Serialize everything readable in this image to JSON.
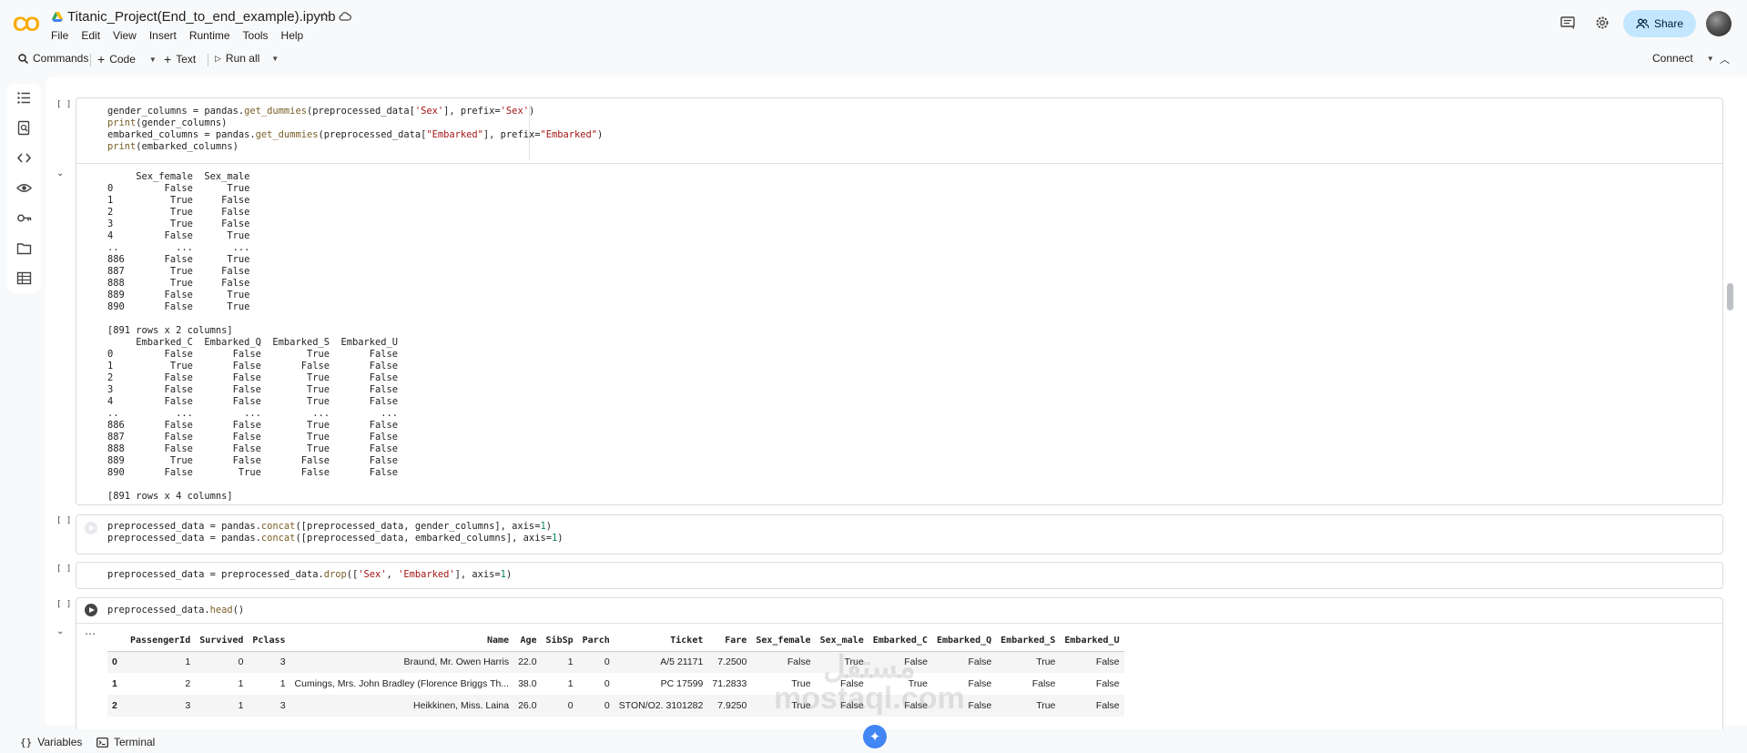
{
  "app": {
    "logo_text": "CO",
    "notebook_title": "Titanic_Project(End_to_end_example).ipynb",
    "menu": [
      "File",
      "Edit",
      "View",
      "Insert",
      "Runtime",
      "Tools",
      "Help"
    ],
    "share_label": "Share"
  },
  "toolbar": {
    "commands": "Commands",
    "code": "Code",
    "text": "Text",
    "run_all": "Run all",
    "connect": "Connect"
  },
  "cells": {
    "bracket": "[ ]",
    "cell1_code": [
      "gender_columns = pandas.get_dummies(preprocessed_data['Sex'], prefix='Sex')",
      "print(gender_columns)",
      "embarked_columns = pandas.get_dummies(preprocessed_data[\"Embarked\"], prefix=\"Embarked\")",
      "print(embarked_columns)"
    ],
    "cell1_output": "     Sex_female  Sex_male\n0         False      True\n1          True     False\n2          True     False\n3          True     False\n4         False      True\n..          ...       ...\n886       False      True\n887        True     False\n888        True     False\n889       False      True\n890       False      True\n\n[891 rows x 2 columns]\n     Embarked_C  Embarked_Q  Embarked_S  Embarked_U\n0         False       False        True       False\n1          True       False       False       False\n2         False       False        True       False\n3         False       False        True       False\n4         False       False        True       False\n..          ...         ...         ...         ...\n886       False       False        True       False\n887       False       False        True       False\n888       False       False        True       False\n889        True       False       False       False\n890       False        True       False       False\n\n[891 rows x 4 columns]",
    "cell2_code": [
      "preprocessed_data = pandas.concat([preprocessed_data, gender_columns], axis=1)",
      "preprocessed_data = pandas.concat([preprocessed_data, embarked_columns], axis=1)"
    ],
    "cell3_code": "preprocessed_data = preprocessed_data.drop(['Sex', 'Embarked'], axis=1)",
    "cell4_code": "preprocessed_data.head()"
  },
  "dataframe": {
    "columns": [
      "",
      "PassengerId",
      "Survived",
      "Pclass",
      "Name",
      "Age",
      "SibSp",
      "Parch",
      "Ticket",
      "Fare",
      "Sex_female",
      "Sex_male",
      "Embarked_C",
      "Embarked_Q",
      "Embarked_S",
      "Embarked_U"
    ],
    "rows": [
      [
        "0",
        "1",
        "0",
        "3",
        "Braund, Mr. Owen Harris",
        "22.0",
        "1",
        "0",
        "A/5 21171",
        "7.2500",
        "False",
        "True",
        "False",
        "False",
        "True",
        "False"
      ],
      [
        "1",
        "2",
        "1",
        "1",
        "Cumings, Mrs. John Bradley (Florence Briggs Th...",
        "38.0",
        "1",
        "0",
        "PC 17599",
        "71.2833",
        "True",
        "False",
        "True",
        "False",
        "False",
        "False"
      ],
      [
        "2",
        "3",
        "1",
        "3",
        "Heikkinen, Miss. Laina",
        "26.0",
        "0",
        "0",
        "STON/O2. 3101282",
        "7.9250",
        "True",
        "False",
        "False",
        "False",
        "True",
        "False"
      ]
    ]
  },
  "statusbar": {
    "variables": "Variables",
    "terminal": "Terminal"
  },
  "watermark": {
    "arabic": "مستقل",
    "latin": "mostaql.com"
  }
}
